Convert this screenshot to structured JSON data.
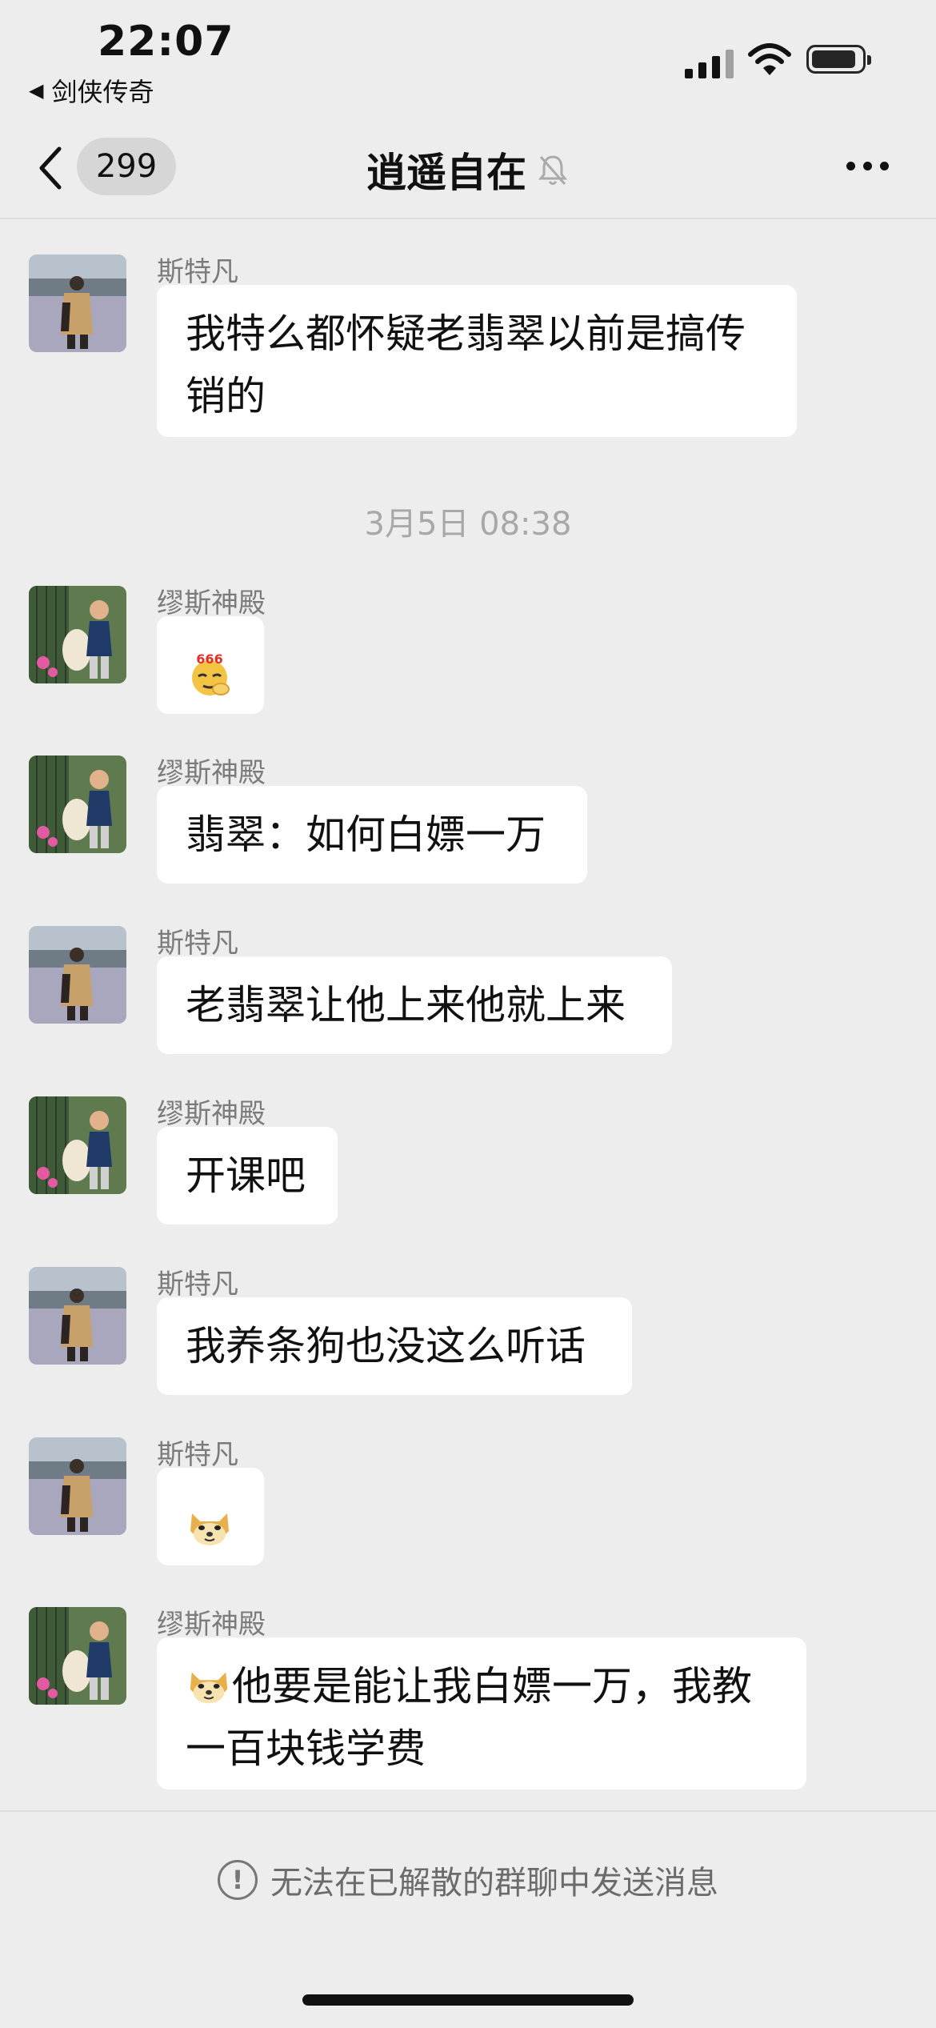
{
  "status_bar": {
    "time": "22:07",
    "back_app": "剑侠传奇"
  },
  "nav": {
    "back_count": "299",
    "title": "逍遥自在"
  },
  "timestamp": "3月5日 08:38",
  "messages": [
    {
      "sender": "斯特凡",
      "text": "我特么都怀疑老翡翠以前是搞传销的"
    },
    {
      "sender": "缪斯神殿",
      "emoji": "666-emoji"
    },
    {
      "sender": "缪斯神殿",
      "text": "翡翠：如何白嫖一万"
    },
    {
      "sender": "斯特凡",
      "text": "老翡翠让他上来他就上来"
    },
    {
      "sender": "缪斯神殿",
      "text": "开课吧"
    },
    {
      "sender": "斯特凡",
      "text": "我养条狗也没这么听话"
    },
    {
      "sender": "斯特凡",
      "emoji": "doge-emoji"
    },
    {
      "sender": "缪斯神殿",
      "emoji": "doge-emoji",
      "text": "他要是能让我白嫖一万，我教一百块钱学费"
    }
  ],
  "footer": {
    "note": "无法在已解散的群聊中发送消息"
  }
}
